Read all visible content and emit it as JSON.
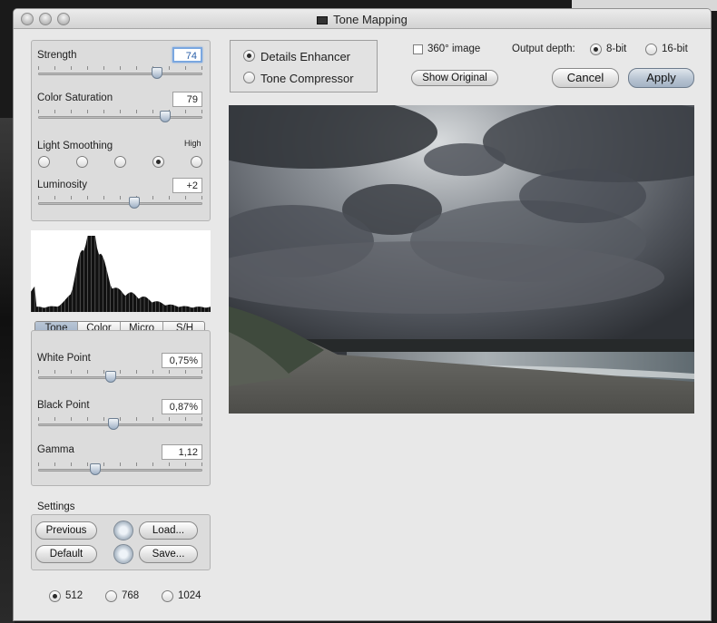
{
  "window": {
    "title": "Tone Mapping"
  },
  "mode": {
    "option1": "Details Enhancer",
    "option2": "Tone Compressor",
    "selected": "Details Enhancer"
  },
  "top": {
    "image360_label": "360° image",
    "output_depth_label": "Output depth:",
    "bit8_label": "8-bit",
    "bit16_label": "16-bit",
    "show_original_label": "Show Original",
    "cancel_label": "Cancel",
    "apply_label": "Apply"
  },
  "controls": {
    "strength": {
      "label": "Strength",
      "value": "74",
      "level": 0.74
    },
    "saturation": {
      "label": "Color Saturation",
      "value": "79",
      "level": 0.79
    },
    "light_smoothing": {
      "label": "Light Smoothing",
      "high_label": "High",
      "selected_index": 3
    },
    "luminosity": {
      "label": "Luminosity",
      "value": "+2",
      "level": 0.59
    }
  },
  "tabs": [
    "Tone",
    "Color",
    "Micro",
    "S/H"
  ],
  "tone": {
    "white_point": {
      "label": "White Point",
      "value": "0,75%",
      "level": 0.44
    },
    "black_point": {
      "label": "Black Point",
      "value": "0,87%",
      "level": 0.45
    },
    "gamma": {
      "label": "Gamma",
      "value": "1,12",
      "level": 0.35
    }
  },
  "settings": {
    "title": "Settings",
    "previous_label": "Previous",
    "default_label": "Default",
    "load_label": "Load...",
    "save_label": "Save..."
  },
  "preview_sizes": {
    "s512": "512",
    "s768": "768",
    "s1024": "1024",
    "selected": "512"
  }
}
